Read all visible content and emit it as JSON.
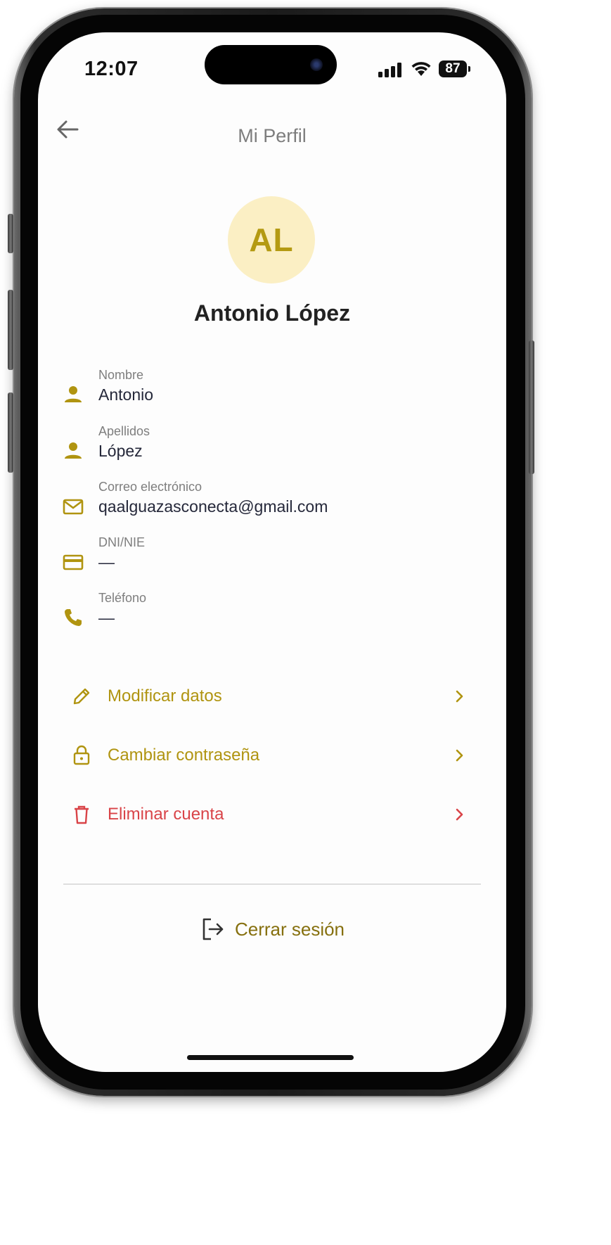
{
  "status_bar": {
    "time": "12:07",
    "battery": "87"
  },
  "header": {
    "title": "Mi Perfil"
  },
  "profile": {
    "initials": "AL",
    "full_name": "Antonio López",
    "fields": [
      {
        "label": "Nombre",
        "value": "Antonio",
        "icon": "person-icon"
      },
      {
        "label": "Apellidos",
        "value": "López",
        "icon": "person-icon"
      },
      {
        "label": "Correo electrónico",
        "value": "qaalguazasconecta@gmail.com",
        "icon": "mail-icon"
      },
      {
        "label": "DNI/NIE",
        "value": "—",
        "icon": "id-card-icon"
      },
      {
        "label": "Teléfono",
        "value": "—",
        "icon": "phone-icon"
      }
    ]
  },
  "actions": [
    {
      "label": "Modificar datos",
      "icon": "pencil-icon",
      "color": "#b09410"
    },
    {
      "label": "Cambiar contraseña",
      "icon": "lock-icon",
      "color": "#b09410"
    },
    {
      "label": "Eliminar cuenta",
      "icon": "trash-icon",
      "color": "#d94448"
    }
  ],
  "logout": {
    "label": "Cerrar sesión",
    "icon": "logout-icon"
  },
  "colors": {
    "accent": "#b09410",
    "danger": "#d94448",
    "avatar_bg": "#fbefc4"
  }
}
